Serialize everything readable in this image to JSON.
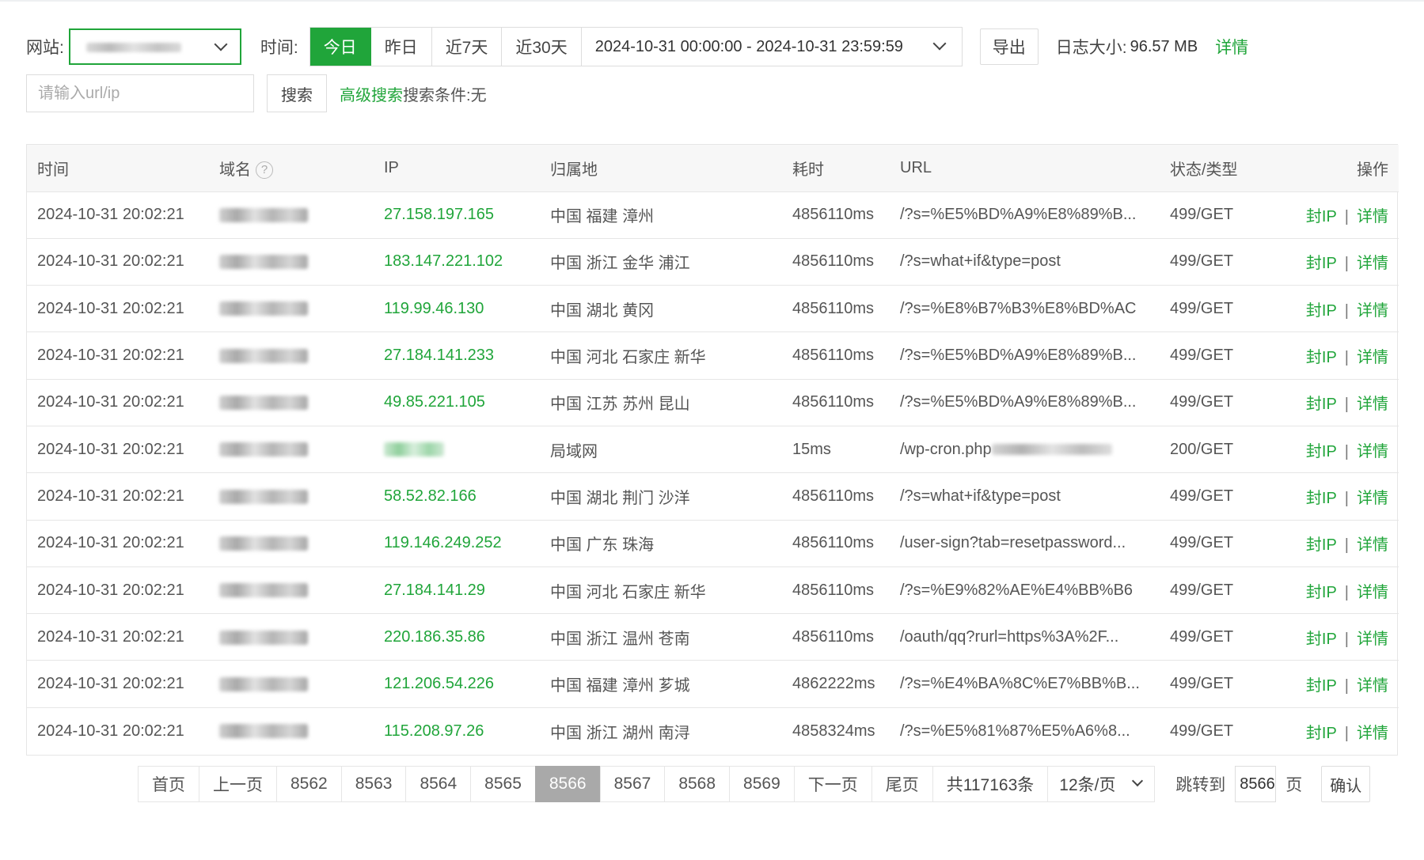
{
  "toolbar": {
    "site_label": "网站:",
    "time_label": "时间:",
    "time_buttons": [
      "今日",
      "昨日",
      "近7天",
      "近30天"
    ],
    "active_time": "今日",
    "date_range": "2024-10-31 00:00:00 - 2024-10-31 23:59:59",
    "export_label": "导出",
    "log_size_label": "日志大小:",
    "log_size_value": "96.57 MB",
    "detail_label": "详情",
    "search_placeholder": "请输入url/ip",
    "search_label": "搜索",
    "advanced_search_label": "高级搜索",
    "condition_label": "搜索条件:",
    "condition_value": "无"
  },
  "table": {
    "headers": [
      "时间",
      "域名",
      "IP",
      "归属地",
      "耗时",
      "URL",
      "状态/类型",
      "操作"
    ],
    "rows": [
      {
        "time": "2024-10-31 20:02:21",
        "ip": "27.158.197.165",
        "location": "中国 福建 漳州",
        "duration": "4856110ms",
        "url": "/?s=%E5%BD%A9%E8%89%B...",
        "status": "499/GET"
      },
      {
        "time": "2024-10-31 20:02:21",
        "ip": "183.147.221.102",
        "location": "中国 浙江 金华 浦江",
        "duration": "4856110ms",
        "url": "/?s=what+if&type=post",
        "status": "499/GET"
      },
      {
        "time": "2024-10-31 20:02:21",
        "ip": "119.99.46.130",
        "location": "中国 湖北 黄冈",
        "duration": "4856110ms",
        "url": "/?s=%E8%B7%B3%E8%BD%AC",
        "status": "499/GET"
      },
      {
        "time": "2024-10-31 20:02:21",
        "ip": "27.184.141.233",
        "location": "中国 河北 石家庄 新华",
        "duration": "4856110ms",
        "url": "/?s=%E5%BD%A9%E8%89%B...",
        "status": "499/GET"
      },
      {
        "time": "2024-10-31 20:02:21",
        "ip": "49.85.221.105",
        "location": "中国 江苏 苏州 昆山",
        "duration": "4856110ms",
        "url": "/?s=%E5%BD%A9%E8%89%B...",
        "status": "499/GET"
      },
      {
        "time": "2024-10-31 20:02:21",
        "ip": "",
        "location": "局域网",
        "duration": "15ms",
        "url": "/wp-cron.php",
        "status": "200/GET"
      },
      {
        "time": "2024-10-31 20:02:21",
        "ip": "58.52.82.166",
        "location": "中国 湖北 荆门 沙洋",
        "duration": "4856110ms",
        "url": "/?s=what+if&type=post",
        "status": "499/GET"
      },
      {
        "time": "2024-10-31 20:02:21",
        "ip": "119.146.249.252",
        "location": "中国 广东 珠海",
        "duration": "4856110ms",
        "url": "/user-sign?tab=resetpassword...",
        "status": "499/GET"
      },
      {
        "time": "2024-10-31 20:02:21",
        "ip": "27.184.141.29",
        "location": "中国 河北 石家庄 新华",
        "duration": "4856110ms",
        "url": "/?s=%E9%82%AE%E4%BB%B6",
        "status": "499/GET"
      },
      {
        "time": "2024-10-31 20:02:21",
        "ip": "220.186.35.86",
        "location": "中国 浙江 温州 苍南",
        "duration": "4856110ms",
        "url": "/oauth/qq?rurl=https%3A%2F...",
        "status": "499/GET"
      },
      {
        "time": "2024-10-31 20:02:21",
        "ip": "121.206.54.226",
        "location": "中国 福建 漳州 芗城",
        "duration": "4862222ms",
        "url": "/?s=%E4%BA%8C%E7%BB%B...",
        "status": "499/GET"
      },
      {
        "time": "2024-10-31 20:02:21",
        "ip": "115.208.97.26",
        "location": "中国 浙江 湖州 南浔",
        "duration": "4858324ms",
        "url": "/?s=%E5%81%87%E5%A6%8...",
        "status": "499/GET"
      }
    ],
    "action_block_ip": "封IP",
    "action_separator": "|",
    "action_detail": "详情"
  },
  "pagination": {
    "first": "首页",
    "prev": "上一页",
    "pages": [
      "8562",
      "8563",
      "8564",
      "8565",
      "8566",
      "8567",
      "8568",
      "8569"
    ],
    "current": "8566",
    "next": "下一页",
    "last": "尾页",
    "total": "共117163条",
    "per_page": "12条/页",
    "jump_label": "跳转到",
    "jump_value": "8566",
    "page_unit": "页",
    "confirm": "确认"
  },
  "colors": {
    "accent": "#20a53a",
    "active_page": "#a9a9a9",
    "header_bg": "#f7f7f7",
    "border": "#e6e6e6"
  }
}
